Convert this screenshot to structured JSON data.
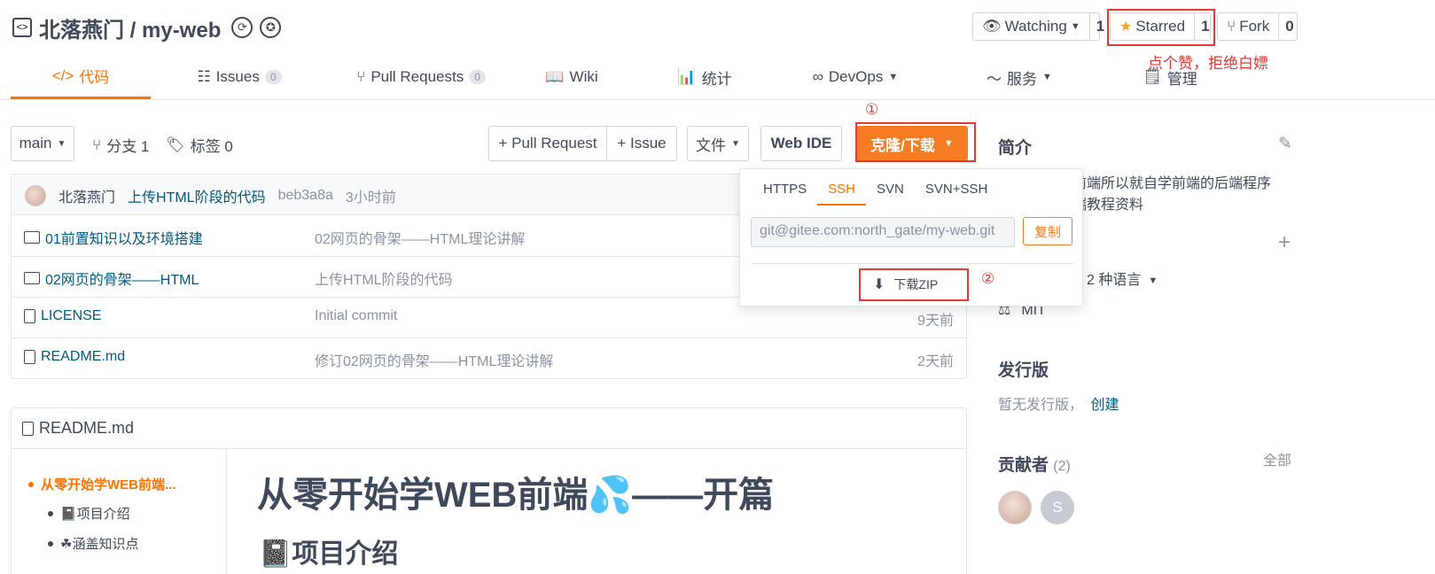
{
  "header": {
    "repo_title": "北落燕门 / my-web",
    "watching_label": "Watching",
    "watching_count": "1",
    "starred_label": "Starred",
    "starred_count": "1",
    "fork_label": "Fork",
    "fork_count": "0",
    "annotation_star": "点个赞，拒绝白嫖"
  },
  "tabs": [
    {
      "label": "代码",
      "icon": "code-icon",
      "active": true
    },
    {
      "label": "Issues",
      "badge": "0",
      "icon": "issues-icon"
    },
    {
      "label": "Pull Requests",
      "badge": "0",
      "icon": "pull-request-icon"
    },
    {
      "label": "Wiki",
      "icon": "book-icon"
    },
    {
      "label": "统计",
      "icon": "chart-icon"
    },
    {
      "label": "DevOps",
      "icon": "infinity-icon"
    },
    {
      "label": "服务",
      "icon": "pulse-icon"
    },
    {
      "label": "管理",
      "icon": "manage-icon"
    }
  ],
  "toolbar": {
    "branch": "main",
    "branches": "分支 1",
    "tags": "标签 0",
    "pull_request_btn": "+ Pull Request",
    "issue_btn": "+ Issue",
    "file_btn": "文件",
    "web_ide_btn": "Web IDE",
    "clone_btn": "克隆/下载",
    "annotation_1": "①",
    "annotation_2": "②"
  },
  "commit": {
    "author": "北落燕门",
    "message": "上传HTML阶段的代码",
    "hash": "beb3a8a",
    "time": "3小时前"
  },
  "files": [
    {
      "name": "01前置知识以及环境搭建",
      "type": "folder",
      "message": "02网页的骨架——HTML理论讲解",
      "time": ""
    },
    {
      "name": "02网页的骨架——HTML",
      "type": "folder",
      "message": "上传HTML阶段的代码",
      "time": ""
    },
    {
      "name": "LICENSE",
      "type": "file",
      "message": "Initial commit",
      "time": "9天前"
    },
    {
      "name": "README.md",
      "type": "file",
      "message": "修订02网页的骨架——HTML理论讲解",
      "time": "2天前"
    }
  ],
  "clone_dropdown": {
    "protocols": [
      "HTTPS",
      "SSH",
      "SVN",
      "SVN+SSH"
    ],
    "active_protocol": "SSH",
    "url": "git@gitee.com:north_gate/my-web.git",
    "copy_btn": "复制",
    "download_zip": "下载ZIP"
  },
  "readme": {
    "title": "README.md",
    "toc": [
      {
        "label": "从零开始学WEB前端...",
        "level": 1,
        "active": true
      },
      {
        "label": "📓项目介绍",
        "level": 2
      },
      {
        "label": "☘涵盖知识点",
        "level": 2
      }
    ],
    "h1": "从零开始学WEB前端💦——开篇",
    "h2": "📓项目介绍"
  },
  "sidebar": {
    "intro_title": "简介",
    "intro_text_1": "前端所以就自学前端的后端程序",
    "intro_text_2": "端教程资料",
    "languages": "2 种语言",
    "license": "MIT",
    "release_title": "发行版",
    "release_empty": "暂无发行版，",
    "release_create": "创建",
    "contributors_title": "贡献者",
    "contributors_count": "(2)",
    "contributors_all": "全部",
    "contributor_initial": "S"
  },
  "colors": {
    "accent": "#fe7300",
    "clone_button": "#f57c22",
    "annotation": "#e53935",
    "link": "#005980"
  }
}
